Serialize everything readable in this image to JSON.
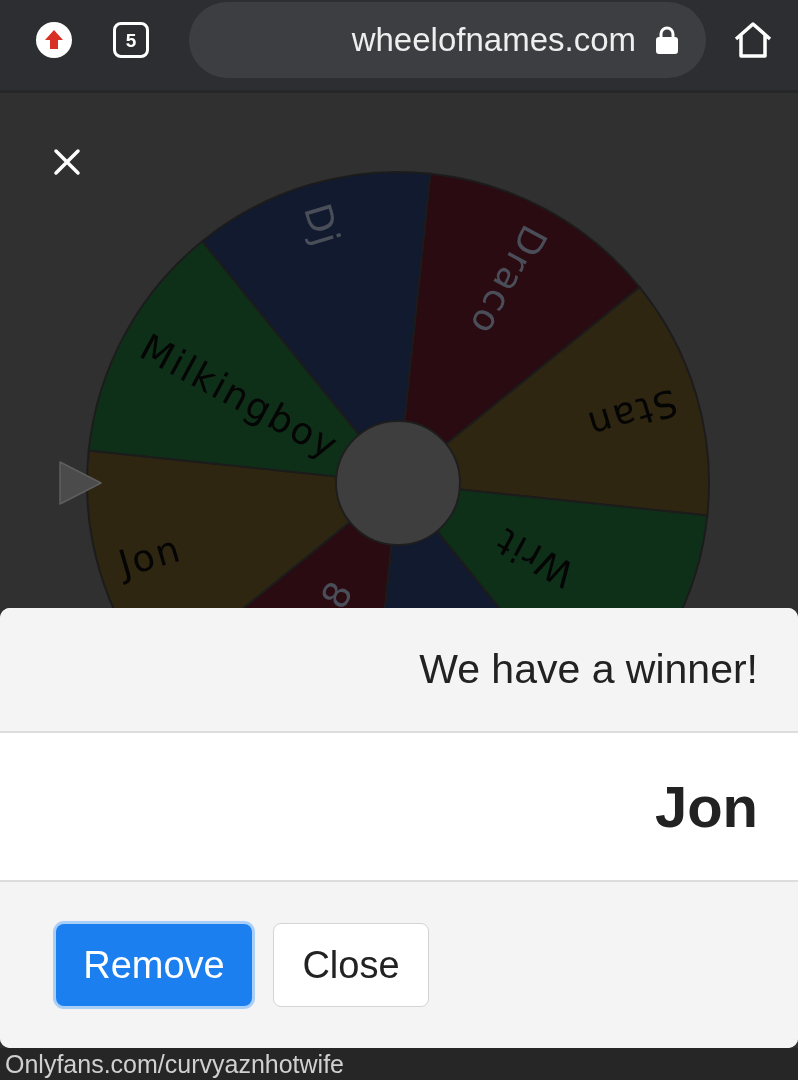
{
  "browser": {
    "url": "wheelofnames.com",
    "tab_count": "5"
  },
  "wheel": {
    "segments": [
      {
        "label": "Dj",
        "color": "#111a2f",
        "light_text": true,
        "kind": "rim"
      },
      {
        "label": "Draco",
        "color": "#2a0b11",
        "light_text": true,
        "kind": "rim"
      },
      {
        "label": "Stan",
        "color": "#2e2610",
        "light_text": false,
        "kind": "rim"
      },
      {
        "label": "Writ",
        "color": "#0f3018",
        "light_text": false,
        "kind": "inner"
      },
      {
        "color": "#111a2f"
      },
      {
        "label": "8",
        "color": "#2a0b11",
        "light_text": true,
        "kind": "inner"
      },
      {
        "label": "Jon",
        "color": "#2e2610",
        "light_text": false,
        "kind": "rim"
      },
      {
        "label": "Milkingboy",
        "color": "#0f3018",
        "light_text": false,
        "kind": "rim"
      }
    ]
  },
  "winner_dialog": {
    "title": "We have a winner!",
    "winner": "Jon",
    "buttons": [
      {
        "label": "Remove",
        "kind": "primary",
        "focused": true
      },
      {
        "label": "Close",
        "kind": "secondary",
        "focused": false
      }
    ]
  },
  "status_bar": {
    "link": "Onlyfans.com/curvyaznhotwife"
  }
}
